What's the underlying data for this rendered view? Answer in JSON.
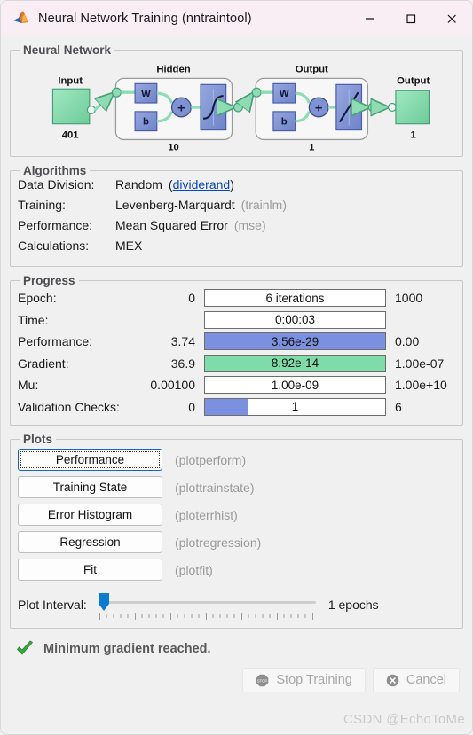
{
  "window": {
    "title": "Neural Network Training (nntraintool)",
    "icon": "matlab-membrane-icon",
    "minimize_label": "—",
    "maximize_label": "☐",
    "close_label": "✕"
  },
  "neural_network": {
    "legend": "Neural Network",
    "input_label": "Input",
    "input_size": "401",
    "hidden_label": "Hidden",
    "hidden_size": "10",
    "output_layer_label": "Output",
    "output_layer_size": "1",
    "output_label": "Output",
    "output_size": "1",
    "weight_label": "W",
    "bias_label": "b",
    "sum_label": "+",
    "colors": {
      "block_green": "#7fd9a8",
      "block_blue": "#7f93d4",
      "connector_green": "#8ddcb4",
      "node_fill": "#8ddcb4"
    }
  },
  "algorithms": {
    "legend": "Algorithms",
    "rows": [
      {
        "label": "Data Division:",
        "value": "Random",
        "fn": "dividerand",
        "fn_is_link": true
      },
      {
        "label": "Training:",
        "value": "Levenberg-Marquardt",
        "fn": "trainlm",
        "fn_is_link": false
      },
      {
        "label": "Performance:",
        "value": "Mean Squared Error",
        "fn": "mse",
        "fn_is_link": false
      },
      {
        "label": "Calculations:",
        "value": "MEX",
        "fn": "",
        "fn_is_link": false
      }
    ]
  },
  "progress": {
    "legend": "Progress",
    "rows": [
      {
        "label": "Epoch:",
        "start": "0",
        "bar_text": "6 iterations",
        "target": "1000",
        "fill": "none",
        "pct": 0,
        "color": ""
      },
      {
        "label": "Time:",
        "start": "",
        "bar_text": "0:00:03",
        "target": "",
        "fill": "none",
        "pct": 0,
        "color": ""
      },
      {
        "label": "Performance:",
        "start": "3.74",
        "bar_text": "3.56e-29",
        "target": "0.00",
        "fill": "full",
        "pct": 100,
        "color": "#7b90de"
      },
      {
        "label": "Gradient:",
        "start": "36.9",
        "bar_text": "8.92e-14",
        "target": "1.00e-07",
        "fill": "full",
        "pct": 100,
        "color": "#7fdca8"
      },
      {
        "label": "Mu:",
        "start": "0.00100",
        "bar_text": "1.00e-09",
        "target": "1.00e+10",
        "fill": "none",
        "pct": 0,
        "color": ""
      },
      {
        "label": "Validation Checks:",
        "start": "0",
        "bar_text": "1",
        "target": "6",
        "fill": "part",
        "pct": 24,
        "color": "#7b90de"
      }
    ]
  },
  "plots": {
    "legend": "Plots",
    "buttons": [
      {
        "label": "Performance",
        "fn": "(plotperform)",
        "focused": true
      },
      {
        "label": "Training State",
        "fn": "(plottrainstate)",
        "focused": false
      },
      {
        "label": "Error Histogram",
        "fn": "(ploterrhist)",
        "focused": false
      },
      {
        "label": "Regression",
        "fn": "(plotregression)",
        "focused": false
      },
      {
        "label": "Fit",
        "fn": "(plotfit)",
        "focused": false
      }
    ],
    "interval_label": "Plot Interval:",
    "interval_value": "1 epochs",
    "interval_position_pct": 2
  },
  "status": {
    "icon": "green-check-icon",
    "message": "Minimum gradient reached."
  },
  "footer": {
    "stop_label": "Stop Training",
    "stop_icon": "stop-octagon-icon",
    "cancel_label": "Cancel",
    "cancel_icon": "cancel-circle-icon",
    "disabled": true
  },
  "watermark": "CSDN @EchoToMe"
}
